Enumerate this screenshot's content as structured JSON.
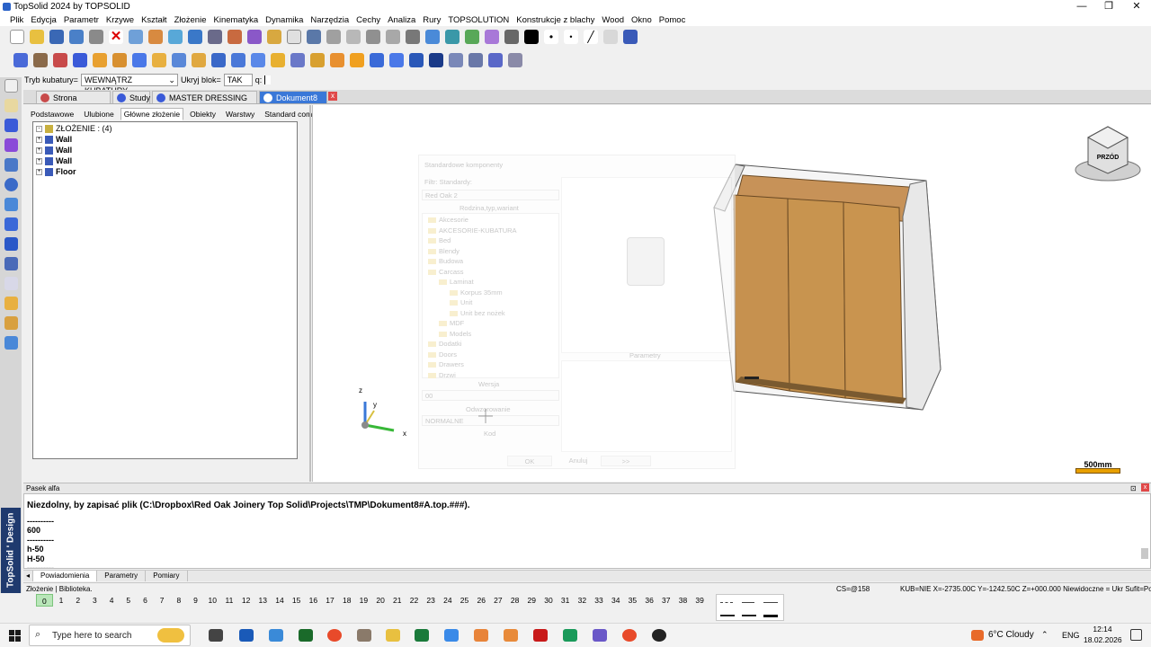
{
  "window": {
    "title": "TopSolid 2024 by TOPSOLID",
    "minimize": "—",
    "maximize": "❐",
    "close": "✕"
  },
  "menu": [
    "Plik",
    "Edycja",
    "Parametr",
    "Krzywe",
    "Kształt",
    "Złożenie",
    "Kinematyka",
    "Dynamika",
    "Narzędzia",
    "Cechy",
    "Analiza",
    "Rury",
    "TOPSOLUTION",
    "Konstrukcje z blachy",
    "Wood",
    "Okno",
    "Pomoc"
  ],
  "options": {
    "kubatura_label": "Tryb kubatury=",
    "kubatura_value": "WEWNĄTRZ KUBATURY",
    "ukryj_label": "Ukryj blok=",
    "ukryj_value": "TAK",
    "q_label": "q:"
  },
  "doc_tabs": [
    "Strona startowa",
    "Study",
    "MASTER DRESSING ROOM",
    "Dokument8 *"
  ],
  "panel_tabs": [
    "Podstawowe",
    "Ulubione",
    "Główne złożenie",
    "Obiekty",
    "Warstwy",
    "Standard components"
  ],
  "tree": {
    "root": "ZŁOŻENIE : (4)",
    "items": [
      "Wall",
      "Wall",
      "Wall",
      "Floor"
    ]
  },
  "dialog": {
    "title": "Standardowe komponenty",
    "filtr_label": "Filtr: Standardy:",
    "dir_value": "Red Oak 2",
    "rodzina_label": "Rodzina,typ,wariant",
    "tree_items": [
      "Akcesorie",
      "AKCESORIE-KUBATURA",
      "Bed",
      "Blendy",
      "Budowa",
      "Carcass",
      "Laminat",
      "Korpus 35mm",
      "Unit",
      "Unit bez nożek",
      "MDF",
      "Models",
      "Dodatki",
      "Doors",
      "Drawers",
      "Drzwi"
    ],
    "wersja_label": "Wersja",
    "wersja_value": "00",
    "odwzorowanie_label": "Odwzorowanie",
    "odwzorowanie_value": "NORMALNE",
    "kod_label": "Kod",
    "parametry_label": "Parametry",
    "ok": "OK",
    "anuluj": "Anuluj",
    "more": ">>"
  },
  "viewcube": {
    "label": "PRZÓD"
  },
  "axes": {
    "z": "z",
    "y": "y",
    "x": "x"
  },
  "scale": {
    "label": "500mm"
  },
  "alpha": {
    "title": "Pasek alfa",
    "lines": [
      "Niezdolny, by zapisać plik (C:\\Dropbox\\Red Oak Joinery Top Solid\\Projects\\TMP\\Dokument8#A.top.###).",
      "----------",
      "600",
      "----------",
      "h-50",
      "H-50",
      "----------"
    ],
    "tabs": [
      "Powiadomienia",
      "Parametry",
      "Pomiary"
    ]
  },
  "status": {
    "left": "Złożenie | Biblioteka.",
    "cs": "CS=@158",
    "coords": "KUB=NIE  X=-2735.00C  Y=-1242.50C  Z=+000.000  Niewidoczne = Ukr  Sufit=Pokaż"
  },
  "numbers": [
    "0",
    "1",
    "2",
    "3",
    "4",
    "5",
    "6",
    "7",
    "8",
    "9",
    "10",
    "11",
    "12",
    "13",
    "14",
    "15",
    "16",
    "17",
    "18",
    "19",
    "20",
    "21",
    "22",
    "23",
    "24",
    "25",
    "26",
    "27",
    "28",
    "29",
    "30",
    "31",
    "32",
    "33",
    "34",
    "35",
    "36",
    "37",
    "38",
    "39"
  ],
  "brand": "TopSolid ' Design",
  "taskbar": {
    "search": "Type here to search",
    "weather": "6°C  Cloudy",
    "lang": "ENG",
    "time": "12:14",
    "date": "18.02.2026"
  }
}
